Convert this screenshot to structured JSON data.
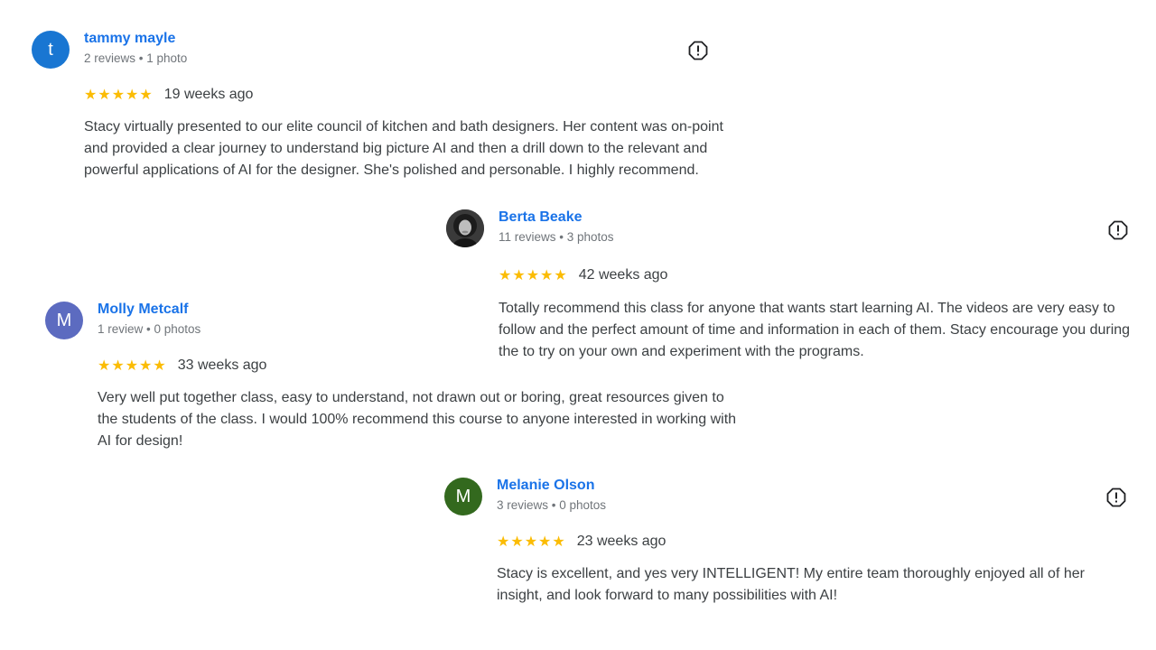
{
  "reviews": [
    {
      "avatar_letter": "t",
      "avatar_color": "#1976d2",
      "name": "tammy mayle",
      "meta": "2 reviews • 1 photo",
      "stars": "★★★★★",
      "date": "19 weeks ago",
      "text": "Stacy virtually presented to our elite council of kitchen and bath designers. Her content was on-point and provided a clear journey to understand big picture AI and then a drill down to the relevant and powerful applications of AI for the designer. She's polished and personable. I highly recommend."
    },
    {
      "avatar_letter": "",
      "avatar_color": "#2b2b2b",
      "name": "Berta Beake",
      "meta": "11 reviews • 3 photos",
      "stars": "★★★★★",
      "date": "42 weeks ago",
      "text": "Totally recommend this class for anyone that wants start learning AI. The videos are very easy to follow and the perfect amount of time and information in each of them. Stacy encourage you during the to try on your own and experiment with the programs."
    },
    {
      "avatar_letter": "M",
      "avatar_color": "#5c6bc0",
      "name": "Molly Metcalf",
      "meta": "1 review • 0 photos",
      "stars": "★★★★★",
      "date": "33 weeks ago",
      "text": "Very well put together class, easy to understand, not drawn out or boring, great resources given to the students of the class. I would 100% recommend this course to anyone interested in working with AI for design!"
    },
    {
      "avatar_letter": "M",
      "avatar_color": "#33691e",
      "name": "Melanie Olson",
      "meta": "3 reviews • 0 photos",
      "stars": "★★★★★",
      "date": "23 weeks ago",
      "text": "Stacy is excellent, and yes very INTELLIGENT! My entire team thoroughly enjoyed all of her insight, and look forward to many possibilities with AI!"
    }
  ],
  "icons": {
    "report": "report-flag-icon",
    "star": "star-icon"
  },
  "colors": {
    "name_link": "#1a73e8",
    "star": "#fbbc04",
    "meta": "#70757a",
    "text": "#3c4043"
  }
}
